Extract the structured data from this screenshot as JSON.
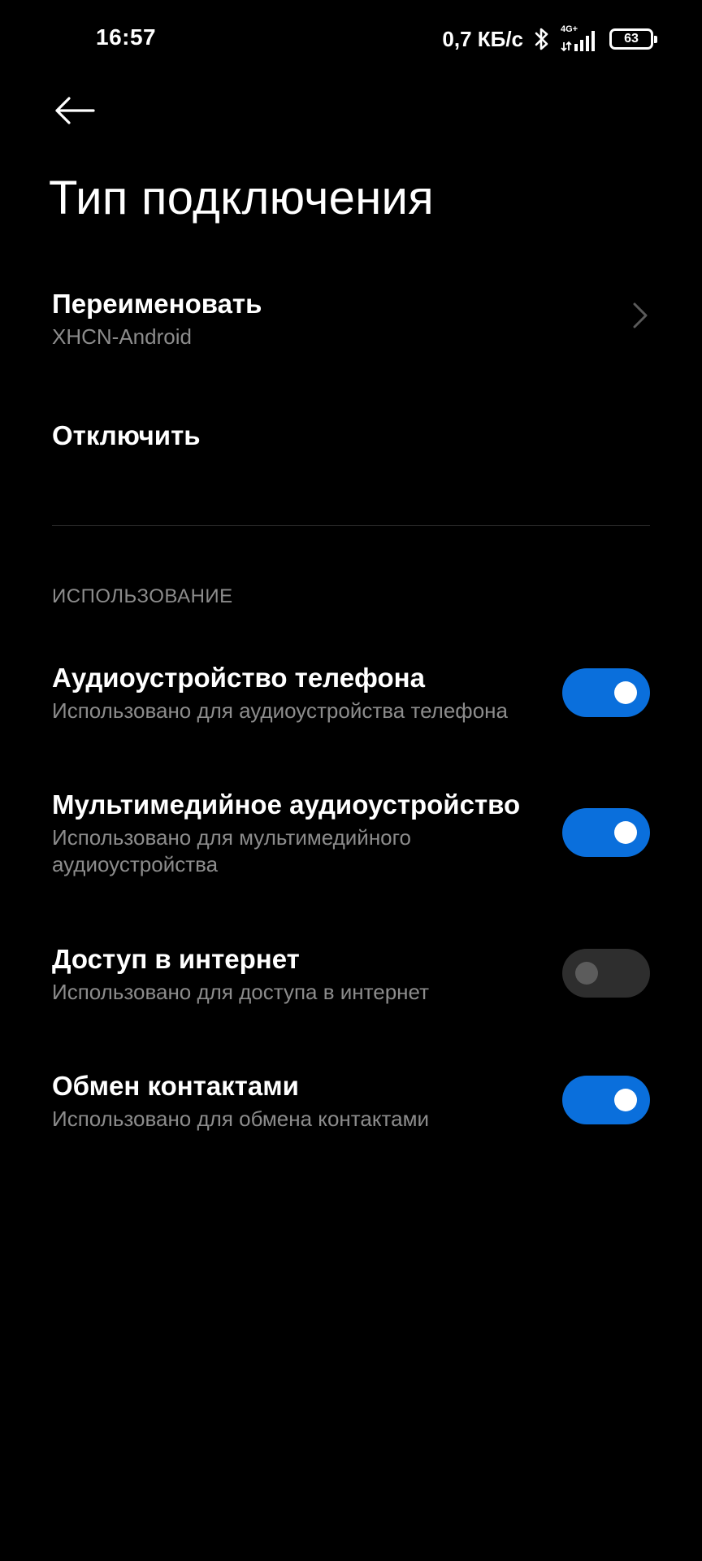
{
  "status_bar": {
    "time": "16:57",
    "net_speed": "0,7 КБ/с",
    "network_type": "4G+",
    "battery_level": "63",
    "icons": [
      "bluetooth-icon",
      "signal-icon",
      "battery-icon"
    ]
  },
  "header": {
    "back_icon": "arrow-left-icon",
    "title": "Тип подключения"
  },
  "actions": {
    "rename": {
      "title": "Переименовать",
      "subtitle": "XHCN-Android"
    },
    "disconnect": {
      "title": "Отключить"
    }
  },
  "usage": {
    "header": "ИСПОЛЬЗОВАНИЕ",
    "items": [
      {
        "title": "Аудиоустройство телефона",
        "subtitle": "Использовано для аудиоустройства телефона",
        "enabled": true
      },
      {
        "title": "Мультимедийное аудиоустройство",
        "subtitle": "Использовано для мультимедийного аудиоустройства",
        "enabled": true
      },
      {
        "title": "Доступ в интернет",
        "subtitle": "Использовано для доступа в интернет",
        "enabled": false
      },
      {
        "title": "Обмен контактами",
        "subtitle": "Использовано для обмена контактами",
        "enabled": true
      }
    ]
  },
  "colors": {
    "background": "#000000",
    "accent": "#0a6fdc",
    "secondary_text": "#8c8c8c",
    "toggle_off": "#2e2e2e"
  }
}
